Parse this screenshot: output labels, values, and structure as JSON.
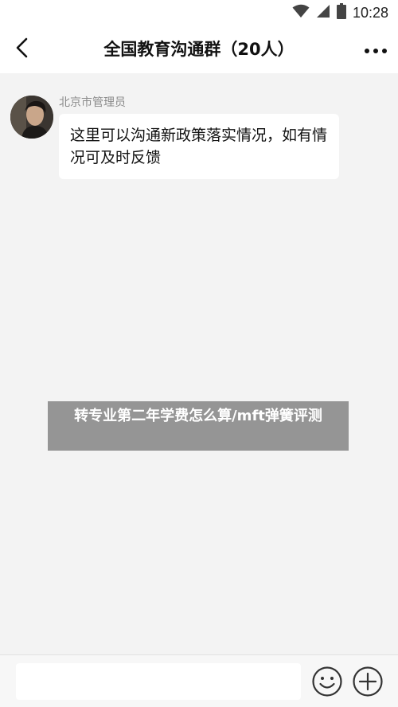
{
  "status_bar": {
    "time": "10:28",
    "icons": [
      "wifi-icon",
      "signal-icon",
      "battery-icon"
    ]
  },
  "header": {
    "title": "全国教育沟通群（20人）",
    "back_icon": "chevron-left-icon",
    "more_icon": "more-horizontal-icon"
  },
  "messages": [
    {
      "sender": "北京市管理员",
      "text": "这里可以沟通新政策落实情况，如有情况可及时反馈",
      "avatar": "avatar"
    }
  ],
  "watermark": {
    "text": "转专业第二年学费怎么算/mft弹簧评测"
  },
  "input_bar": {
    "value": "",
    "placeholder": "",
    "emoji_icon": "emoji-icon",
    "add_icon": "plus-circle-icon"
  },
  "colors": {
    "background": "#f3f3f3",
    "bar": "#ffffff",
    "bubble": "#ffffff",
    "name_text": "#8a8a8a",
    "watermark_bg": "#808080"
  }
}
